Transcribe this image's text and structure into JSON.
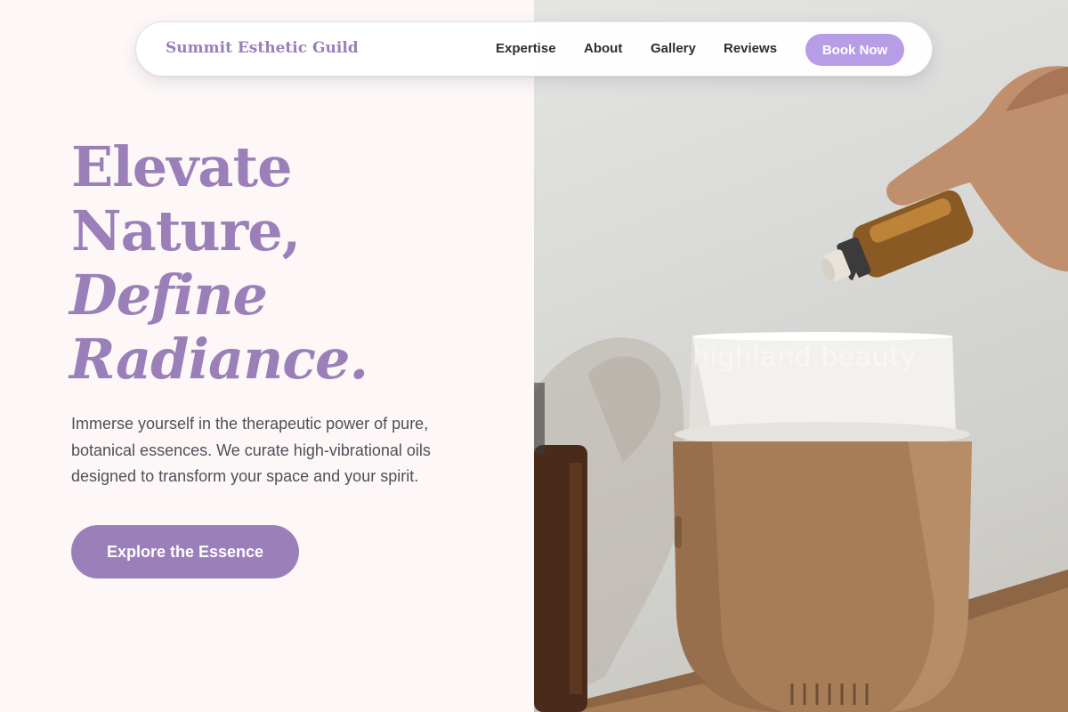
{
  "header": {
    "brand": "Summit Esthetic Guild",
    "nav": [
      "Expertise",
      "About",
      "Gallery",
      "Reviews"
    ],
    "book_label": "Book Now"
  },
  "hero": {
    "line1": "Elevate",
    "line2": "Nature,",
    "line3": "Define",
    "line4": "Radiance.",
    "subtitle": "Immerse yourself in the therapeutic power of pure, botanical essences. We curate high-vibrational oils designed to transform your space and your spirit.",
    "cta_label": "Explore the Essence"
  },
  "photo": {
    "watermark": "highland.beauty"
  },
  "colors": {
    "accent": "#9b7fba",
    "button_light": "#b79de6",
    "background": "#fdf8f7",
    "text": "#4f4f58"
  }
}
